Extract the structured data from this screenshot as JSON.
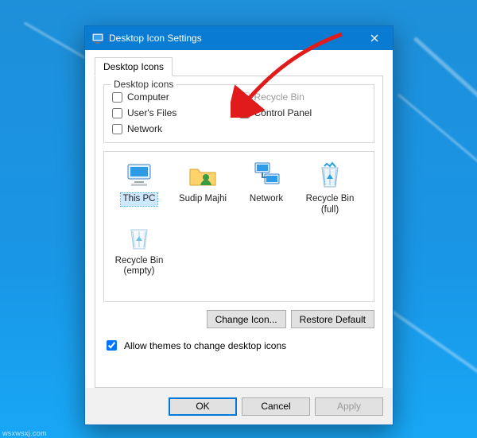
{
  "window": {
    "title": "Desktop Icon Settings",
    "close_aria": "Close"
  },
  "tab": {
    "label": "Desktop Icons"
  },
  "group": {
    "legend": "Desktop icons"
  },
  "checks": {
    "computer": {
      "label": "Computer",
      "checked": false,
      "disabled": false
    },
    "recycle_bin": {
      "label": "Recycle Bin",
      "checked": false,
      "disabled": true
    },
    "users_files": {
      "label": "User's Files",
      "checked": false,
      "disabled": false
    },
    "control_panel": {
      "label": "Control Panel",
      "checked": false,
      "disabled": false
    },
    "network": {
      "label": "Network",
      "checked": false,
      "disabled": false
    }
  },
  "icons": {
    "this_pc": {
      "label": "This PC",
      "selected": true
    },
    "users_files": {
      "label": "Sudip Majhi",
      "selected": false
    },
    "network": {
      "label": "Network",
      "selected": false
    },
    "recycle_bin_full": {
      "label": "Recycle Bin\n(full)",
      "selected": false
    },
    "recycle_bin_empty": {
      "label": "Recycle Bin\n(empty)",
      "selected": false
    }
  },
  "buttons": {
    "change_icon": "Change Icon...",
    "restore_default": "Restore Default",
    "ok": "OK",
    "cancel": "Cancel",
    "apply": "Apply"
  },
  "themes": {
    "label": "Allow themes to change desktop icons",
    "checked": true
  },
  "watermark": "wsxwsxj.com",
  "colors": {
    "titlebar": "#0a7bd3",
    "accent": "#0078d7",
    "arrow": "#e11b1b"
  }
}
